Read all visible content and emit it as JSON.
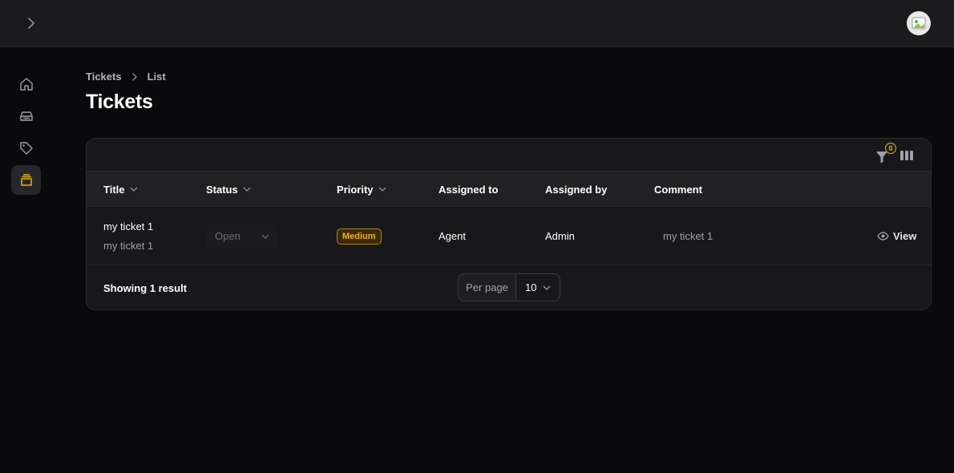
{
  "breadcrumb": {
    "root": "Tickets",
    "current": "List"
  },
  "page": {
    "title": "Tickets"
  },
  "toolbar": {
    "filter_count": "0"
  },
  "table": {
    "headers": {
      "title": "Title",
      "status": "Status",
      "priority": "Priority",
      "assigned_to": "Assigned to",
      "assigned_by": "Assigned by",
      "comment": "Comment"
    },
    "rows": [
      {
        "title": "my ticket 1",
        "subtitle": "my ticket 1",
        "status": "Open",
        "priority": "Medium",
        "assigned_to": "Agent",
        "assigned_by": "Admin",
        "comment": "my ticket 1",
        "action": "View"
      }
    ]
  },
  "footer": {
    "showing": "Showing 1 result",
    "per_page_label": "Per page",
    "per_page_value": "10"
  },
  "colors": {
    "accent": "#eab308",
    "background": "#0a090c",
    "card": "#18181b"
  },
  "icons": {
    "sidebar": [
      "home-icon",
      "inbox-icon",
      "tag-icon",
      "archive-icon"
    ],
    "toolbar": [
      "filter-icon",
      "columns-icon"
    ]
  }
}
